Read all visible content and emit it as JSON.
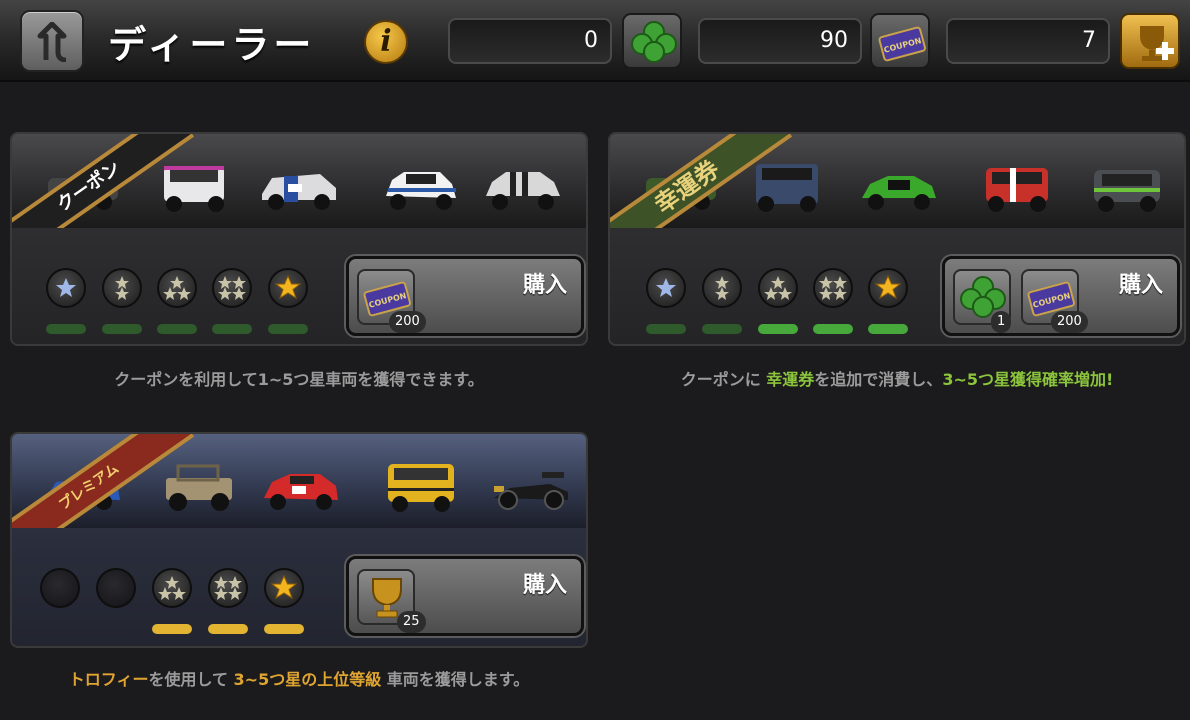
{
  "header": {
    "title": "ディーラー",
    "info_icon": "i",
    "clover_count": "0",
    "coupon_count": "90",
    "trophy_count": "7",
    "coupon_icon_label": "COUPON"
  },
  "colors": {
    "accent_green": "#8cc43c",
    "accent_gold": "#e0a531",
    "ribbon_border": "#b8893a"
  },
  "panels": {
    "coupon": {
      "ribbon": "クーポン",
      "buy_label": "購入",
      "coupon_icon_label": "COUPON",
      "cost": "200",
      "desc": "クーポンを利用して1~5つ星車両を獲得できます。"
    },
    "lucky": {
      "ribbon": "幸運券",
      "buy_label": "購入",
      "coupon_icon_label": "COUPON",
      "clover_cost": "1",
      "coupon_cost": "200",
      "desc_1": "クーポンに ",
      "desc_2": "幸運券",
      "desc_3": "を追加で消費し、",
      "desc_4": "3~5つ星獲得確率増加!"
    },
    "premium": {
      "ribbon": "プレミアム",
      "buy_label": "購入",
      "cost": "25",
      "desc_1": "トロフィー",
      "desc_2": "を使用して ",
      "desc_3": "3~5つ星の上位等級",
      "desc_4": " 車両を獲得します。"
    }
  }
}
